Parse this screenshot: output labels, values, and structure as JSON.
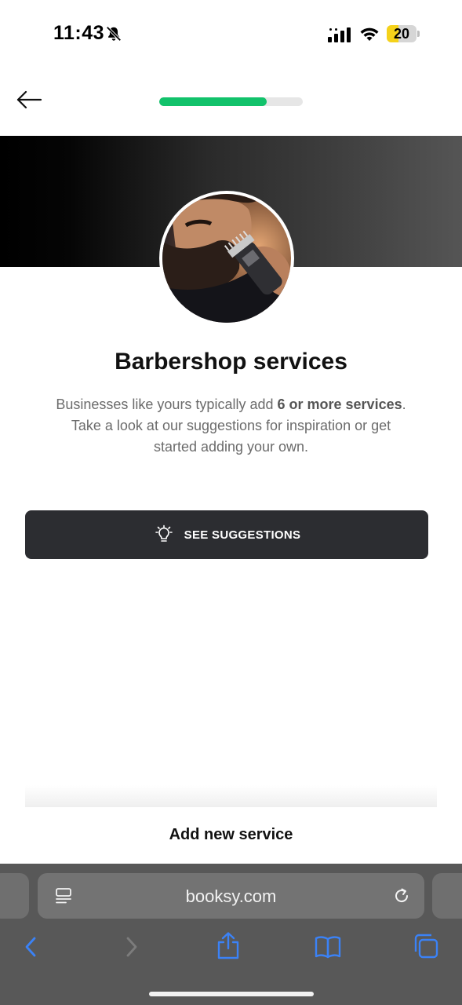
{
  "status_bar": {
    "time": "11:43",
    "battery_level": "20",
    "icons": [
      "bell-off-icon",
      "cellular-signal-icon",
      "wifi-icon",
      "battery-icon"
    ]
  },
  "nav": {
    "back_icon": "arrow-left-icon",
    "progress_fraction": 0.75,
    "progress_color": "#12c26b"
  },
  "hero": {
    "image": "barber trimming beard with clipper",
    "title": "Barbershop services"
  },
  "description": {
    "line1_prefix": "Businesses like yours typically add ",
    "line1_bold": "6 or more services",
    "line1_suffix": ".",
    "line2": "Take a look at our suggestions for inspiration or get started adding your own."
  },
  "suggestions_button": {
    "label": "SEE SUGGESTIONS",
    "icon": "lightbulb-icon",
    "background": "#2c2d31"
  },
  "add_service": {
    "label": "Add new service"
  },
  "browser": {
    "url": "booksy.com",
    "toolbar_icons": [
      "back-icon",
      "forward-icon",
      "share-icon",
      "bookmarks-icon",
      "tabs-icon"
    ],
    "accent": "#3b82f6"
  }
}
